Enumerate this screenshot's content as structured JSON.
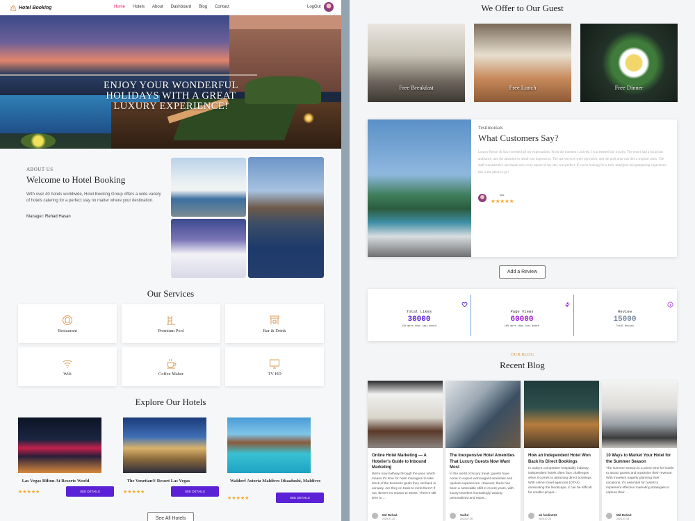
{
  "nav": {
    "brand": "Hotel Booking",
    "menu": [
      "Home",
      "Hotels",
      "About",
      "Dashboard",
      "Blog",
      "Contact"
    ],
    "active": "Home",
    "logout": "LogOut"
  },
  "hero": {
    "title": "Enjoy Your Wonderful Holidays With A Great Luxury Experience!"
  },
  "about": {
    "label": "ABOUT US",
    "title": "Welcome to Hotel Booking",
    "text": "With over 40 hotels worldwide, Hotel Booking Group offers a wide variety of hotels catering for a perfect stay no matter where your destination.",
    "manager_label": "Manager:",
    "manager_name": "Rehad Hasan"
  },
  "services": {
    "title": "Our Services",
    "items": [
      {
        "label": "Restaurant",
        "icon": "dome-icon"
      },
      {
        "label": "Premium Pool",
        "icon": "pool-icon"
      },
      {
        "label": "Bar & Drink",
        "icon": "bar-icon"
      },
      {
        "label": "Wifi",
        "icon": "wifi-icon"
      },
      {
        "label": "Coffee Maker",
        "icon": "coffee-icon"
      },
      {
        "label": "TV HD",
        "icon": "tv-icon"
      }
    ]
  },
  "hotels": {
    "title": "Explore Our Hotels",
    "items": [
      {
        "name": "Las Vegas Hilton At Resorts World",
        "stars": "★★★★★",
        "button": "SEE DETAILS"
      },
      {
        "name": "The Venetian® Resort Las Vegas",
        "stars": "★★★★★",
        "button": "SEE DETAILS"
      },
      {
        "name": "Waldorf Astoria Maldives Ithaafushi, Maldives",
        "stars": "★★★★★",
        "button": "SEE DETAILS"
      }
    ],
    "see_all": "See All Hotels"
  },
  "offers": {
    "title": "We Offer to Our Guest",
    "items": [
      "Free Breakfast",
      "Free Lunch",
      "Free Dinner"
    ]
  },
  "testimonials": {
    "label": "Testimonials",
    "title": "What Customers Say?",
    "text": "Luxury Resort & Spa exceeded all my expectations. From the moment I arrived, I was treated like royalty. The resort had a luxurious ambiance, and the attention to detail was impressive. The spa services were top-notch, and the pool area was like a tropical oasis. The staff was attentive and made sure every aspect of my stay was perfect. If you're looking for a truly indulgent and pampering experience, this is the place to go!",
    "reviewer": "test",
    "stars": "★★★★★",
    "add_review": "Add a Review"
  },
  "stats": [
    {
      "title": "Total Likes",
      "value": "30000",
      "sub": "21% more than last month",
      "color": "#5b21d6"
    },
    {
      "title": "Page Views",
      "value": "60000",
      "sub": "18% more than last month",
      "color": "#9b1ed8"
    },
    {
      "title": "Review",
      "value": "15000",
      "sub": "Total Review",
      "color": "#7a8aa0"
    }
  ],
  "blog": {
    "label": "OUR BLOG",
    "title": "Recent Blog",
    "items": [
      {
        "title": "Online Hotel Marketing — A Hotelier's Guide to Inbound Marketing",
        "text": "We're now halfway through the year, which means it's time for hotel managers to take stock of the business goals they set back in January. Are they on track to meet them? If not, there's no reason to stress. There's still time to ...",
        "author": "Md Rehad",
        "date": "2023-07-24"
      },
      {
        "title": "The Inexpensive Hotel Amenities That Luxury Guests Now Want Most",
        "text": "In the world of luxury travel, guests have come to expect extravagant amenities and opulent experiences. However, there has been a noticeable shift in recent years, with luxury travelers increasingly valuing personalized and exper...",
        "author": "Saiful",
        "date": "2023-07-25"
      },
      {
        "title": "How an Independent Hotel Won Back Its Direct Bookings",
        "text": "In today's competitive hospitality industry, independent hotels often face challenges when it comes to attracting direct bookings. With online travel agencies (OTAs) dominating the landscape, it can be difficult for smaller proper...",
        "author": "ab fardin212",
        "date": "2023-07-24"
      },
      {
        "title": "10 Ways to Market Your Hotel for the Summer Season",
        "text": "The summer season is a prime time for hotels to attract guests and maximize their revenue. With travelers eagerly planning their vacations, it's essential for hotels to implement effective marketing strategies to capture their ...",
        "author": "Md Rehad",
        "date": "2023-07-18"
      }
    ]
  }
}
